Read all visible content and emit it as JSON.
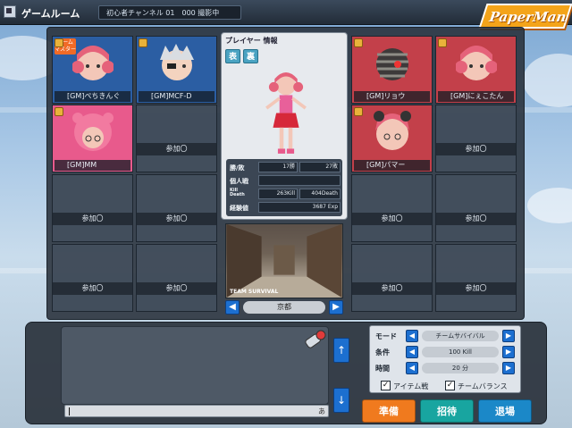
{
  "header": {
    "room_title": "ゲームルーム",
    "channel_text": "初心者チャンネル 01　000 撮影中",
    "logo_text": "PaperMan"
  },
  "slots": [
    {
      "name": "[GM]ぺちきんぐ",
      "badge": "ルーム マスター",
      "color": "#2b5ea3"
    },
    {
      "name": "[GM]MCF-D",
      "color": "#2b5ea3"
    },
    {
      "name": "[GM]MM",
      "color": "#2b5ea3"
    },
    {
      "join": "参加〇"
    },
    {
      "join": "参加〇"
    },
    {
      "join": "参加〇"
    },
    {
      "join": "参加〇"
    },
    {
      "join": "参加〇"
    },
    {
      "name": "[GM]リョウ",
      "color": "#c3404a"
    },
    {
      "name": "[GM]にぇこたん",
      "color": "#c3404a"
    },
    {
      "name": "[GM]パマー",
      "color": "#c3404a"
    },
    {
      "join": "参加〇"
    },
    {
      "join": "参加〇"
    },
    {
      "join": "参加〇"
    },
    {
      "join": "参加〇"
    },
    {
      "join": "参加〇"
    }
  ],
  "player_info": {
    "title": "プレイヤー 情報",
    "tab_front": "表",
    "tab_back": "裏",
    "win_loss_label": "勝/敗",
    "wins": "17勝",
    "losses": "27敗",
    "individual_label": "個人戦",
    "kill_death_label": "Kill Death",
    "kills": "263Kill",
    "deaths": "404Death",
    "exp_label": "経験値",
    "exp": "3687 Exp"
  },
  "map": {
    "label": "TEAM SURVIVAL",
    "name": "京都",
    "prev": "◀",
    "next": "▶"
  },
  "chat": {
    "input_hint": "あ",
    "scroll_up": "↑",
    "scroll_down": "↓"
  },
  "settings": {
    "rows": [
      {
        "label": "モード",
        "value": "チームサバイバル"
      },
      {
        "label": "条件",
        "value": "100 Kill"
      },
      {
        "label": "時間",
        "value": "20 分"
      }
    ],
    "item_battle": "アイテム戦",
    "team_balance": "チームバランス",
    "check_mark": "✓"
  },
  "actions": {
    "ready": "準備",
    "invite": "招待",
    "leave": "退場"
  },
  "colors": {
    "ready": "#f07a1e",
    "invite": "#18a5a0",
    "leave": "#1b88c8"
  }
}
